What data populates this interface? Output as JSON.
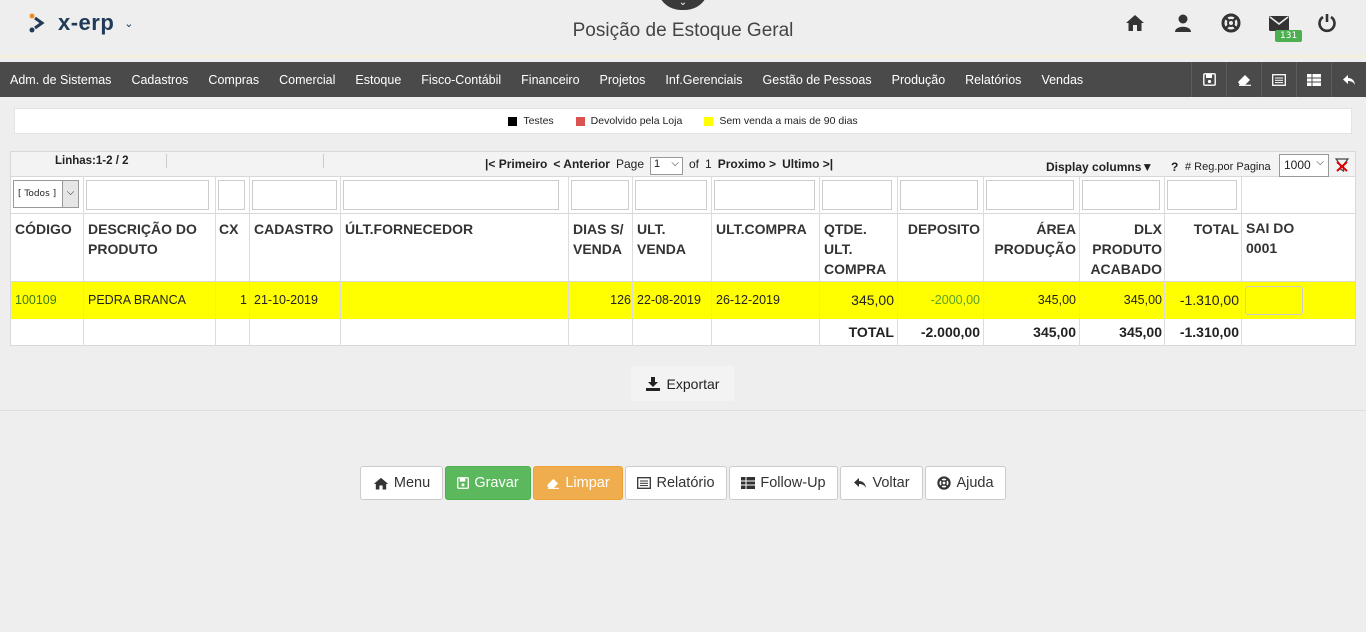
{
  "header": {
    "logo_text": "x-erp",
    "title": "Posição de Estoque Geral",
    "mail_badge": "131",
    "icons": [
      "home-icon",
      "user-icon",
      "lifebuoy-icon",
      "mail-icon",
      "power-icon"
    ]
  },
  "menu": {
    "items": [
      "Adm. de Sistemas",
      "Cadastros",
      "Compras",
      "Comercial",
      "Estoque",
      "Fisco-Contábil",
      "Financeiro",
      "Projetos",
      "Inf.Gerenciais",
      "Gestão de Pessoas",
      "Produção",
      "Relatórios",
      "Vendas"
    ],
    "right_icons": [
      "save-icon",
      "eraser-icon",
      "report-icon",
      "table-icon",
      "back-icon"
    ]
  },
  "legend": [
    {
      "label": "Testes",
      "color": "#000000"
    },
    {
      "label": "Devolvido pela Loja",
      "color": "#d9534f"
    },
    {
      "label": "Sem venda a mais de 90 dias",
      "color": "#ffff00"
    }
  ],
  "pager": {
    "lines": "Linhas:1-2 / 2",
    "first": "|< Primeiro",
    "prev": "< Anterior",
    "page_label": "Page",
    "page_value": "1",
    "of_label": "of",
    "total_pages": "1",
    "next": "Proximo >",
    "last": "Ultimo >|",
    "display_columns": "Display columns▼",
    "help": "?",
    "reg_label": "# Reg.por Pagina",
    "reg_value": "1000"
  },
  "filter": {
    "todos": "[ Todos ]"
  },
  "columns": {
    "codigo": "CÓDIGO",
    "descricao": "DESCRIÇÃO DO PRODUTO",
    "cx": "CX",
    "cadastro": "CADASTRO",
    "fornecedor": "ÚLT.FORNECEDOR",
    "dias": "DIAS S/ VENDA",
    "ult_venda": "ULT. VENDA",
    "ult_compra": "ULT.COMPRA",
    "qtde": "QTDE. ULT. COMPRA",
    "deposito": "DEPOSITO",
    "area": "ÁREA PRODUÇÃO",
    "dlx": "DLX PRODUTO ACABADO",
    "total": "TOTAL",
    "sai": "SAI DO 0001"
  },
  "row": {
    "codigo": "100109",
    "descricao": "PEDRA BRANCA",
    "cx": "1",
    "cadastro": "21-10-2019",
    "fornecedor": "",
    "dias": "126",
    "ult_venda": "22-08-2019",
    "ult_compra": "26-12-2019",
    "qtde": "345,00",
    "deposito": "-2000,00",
    "area": "345,00",
    "dlx": "345,00",
    "total": "-1.310,00"
  },
  "totals": {
    "label": "TOTAL",
    "deposito": "-2.000,00",
    "area": "345,00",
    "dlx": "345,00",
    "total": "-1.310,00"
  },
  "export_label": "Exportar",
  "buttons": {
    "menu": "Menu",
    "gravar": "Gravar",
    "limpar": "Limpar",
    "relatorio": "Relatório",
    "followup": "Follow-Up",
    "voltar": "Voltar",
    "ajuda": "Ajuda"
  }
}
